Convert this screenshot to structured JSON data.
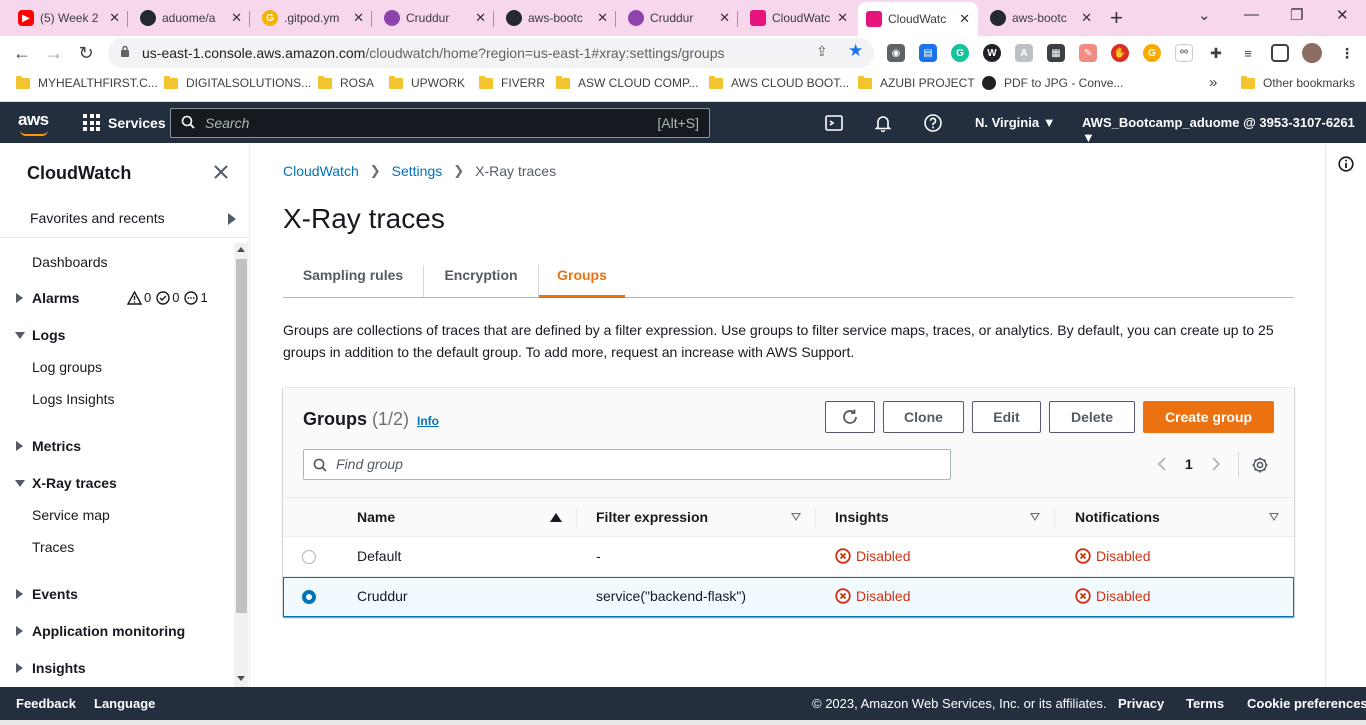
{
  "browser": {
    "tabs": [
      {
        "title": "(5) Week 2",
        "icon": "youtube-icon",
        "color": "#ff0000"
      },
      {
        "title": "aduome/a",
        "icon": "github-icon",
        "color": "#24292f"
      },
      {
        "title": ".gitpod.ym",
        "icon": "google-icon",
        "color": "#f4b400"
      },
      {
        "title": "Cruddur",
        "icon": "cruddur-icon",
        "color": "#8e44ad"
      },
      {
        "title": "aws-bootc",
        "icon": "github-icon",
        "color": "#24292f"
      },
      {
        "title": "Cruddur",
        "icon": "cruddur-icon",
        "color": "#8e44ad"
      },
      {
        "title": "CloudWatc",
        "icon": "cloudwatch-icon",
        "color": "#e7157b"
      },
      {
        "title": "CloudWatc",
        "icon": "cloudwatch-icon",
        "color": "#e7157b"
      },
      {
        "title": "aws-bootc",
        "icon": "github-icon",
        "color": "#24292f"
      }
    ],
    "url_host": "us-east-1.console.aws.amazon.com",
    "url_path": "/cloudwatch/home?region=us-east-1#xray:settings/groups",
    "bookmarks": [
      {
        "label": "MYHEALTHFIRST.C...",
        "type": "folder"
      },
      {
        "label": "DIGITALSOLUTIONS...",
        "type": "folder"
      },
      {
        "label": "ROSA",
        "type": "folder"
      },
      {
        "label": "UPWORK",
        "type": "folder"
      },
      {
        "label": "FIVERR",
        "type": "folder"
      },
      {
        "label": "ASW CLOUD COMP...",
        "type": "folder"
      },
      {
        "label": "AWS CLOUD BOOT...",
        "type": "folder"
      },
      {
        "label": "AZUBI PROJECT",
        "type": "folder"
      },
      {
        "label": "PDF to JPG - Conve...",
        "type": "site"
      }
    ],
    "bookmarks_more": "»",
    "other_bookmarks": "Other bookmarks"
  },
  "aws_nav": {
    "logo": "aws",
    "services_label": "Services",
    "search_placeholder": "Search",
    "search_shortcut": "[Alt+S]",
    "region": "N. Virginia",
    "account": "AWS_Bootcamp_aduome @ 3953-3107-6261"
  },
  "sidebar": {
    "title": "CloudWatch",
    "favorites": "Favorites and recents",
    "items": {
      "dashboards": "Dashboards",
      "alarms": "Alarms",
      "alarm_counts": {
        "alarm": "0",
        "ok": "0",
        "insufficient": "1"
      },
      "logs": "Logs",
      "log_groups": "Log groups",
      "logs_insights": "Logs Insights",
      "metrics": "Metrics",
      "xray": "X-Ray traces",
      "service_map": "Service map",
      "traces": "Traces",
      "events": "Events",
      "app_monitoring": "Application monitoring",
      "insights": "Insights"
    }
  },
  "main": {
    "breadcrumb": [
      "CloudWatch",
      "Settings",
      "X-Ray traces"
    ],
    "title": "X-Ray traces",
    "tabs": [
      "Sampling rules",
      "Encryption",
      "Groups"
    ],
    "active_tab": "Groups",
    "description": "Groups are collections of traces that are defined by a filter expression. Use groups to filter service maps, traces, or analytics. By default, you can create up to 25 groups in addition to the default group. To add more, request an increase with AWS Support.",
    "groups_panel": {
      "title": "Groups",
      "count": "(1/2)",
      "info": "Info",
      "buttons": {
        "clone": "Clone",
        "edit": "Edit",
        "delete": "Delete",
        "create": "Create group"
      },
      "find_placeholder": "Find group",
      "page": "1",
      "columns": {
        "name": "Name",
        "filter": "Filter expression",
        "insights": "Insights",
        "notifications": "Notifications"
      },
      "rows": [
        {
          "name": "Default",
          "filter": "-",
          "insights": "Disabled",
          "notifications": "Disabled",
          "selected": false
        },
        {
          "name": "Cruddur",
          "filter": "service(\"backend-flask\")",
          "insights": "Disabled",
          "notifications": "Disabled",
          "selected": true
        }
      ]
    }
  },
  "footer": {
    "feedback": "Feedback",
    "language": "Language",
    "copyright": "© 2023, Amazon Web Services, Inc. or its affiliates.",
    "privacy": "Privacy",
    "terms": "Terms",
    "cookies": "Cookie preferences"
  },
  "colors": {
    "aws_orange": "#ec7211",
    "aws_navy": "#232f3e",
    "link_blue": "#0073bb",
    "error_red": "#d13212"
  }
}
